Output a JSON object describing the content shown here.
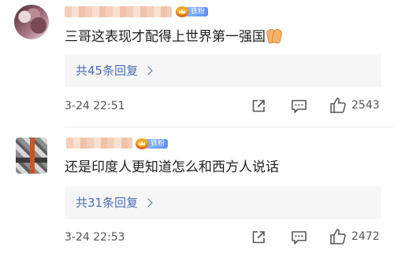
{
  "comments": [
    {
      "badge": "铁粉",
      "text": "三哥这表现才配得上世界第一强国",
      "replies_label": "共45条回复",
      "time": "3-24 22:51",
      "likes": "2543"
    },
    {
      "badge": "铁粉",
      "text": "还是印度人更知道怎么和西方人说话",
      "replies_label": "共31条回复",
      "time": "3-24 22:53",
      "likes": "2472"
    }
  ]
}
